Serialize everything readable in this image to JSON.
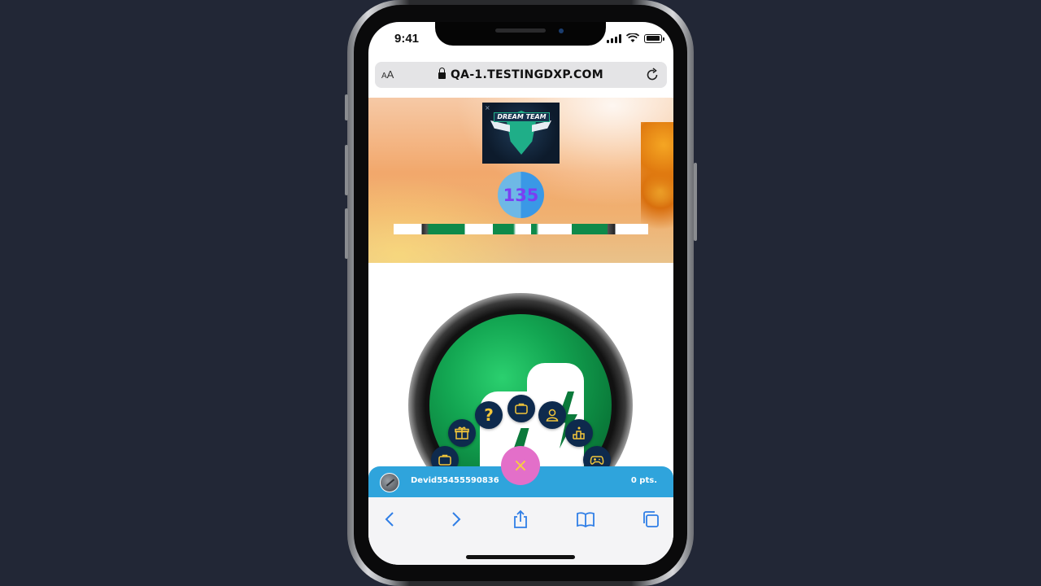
{
  "status_bar": {
    "time": "9:41"
  },
  "browser": {
    "text_size_small": "A",
    "text_size_large": "A",
    "url": "QA-1.TESTINGDXP.COM"
  },
  "banner": {
    "logo_text": "DREAM TEAM",
    "logo_close": "×",
    "score": "135"
  },
  "fab_menu": {
    "close_symbol": "×",
    "items": [
      {
        "icon": "briefcase-icon"
      },
      {
        "icon": "gift-icon"
      },
      {
        "icon": "question-icon",
        "label": "?"
      },
      {
        "icon": "briefcase-icon"
      },
      {
        "icon": "user-icon"
      },
      {
        "icon": "ranking-icon"
      },
      {
        "icon": "gamepad-icon"
      }
    ],
    "icon_color": "#f3c63a",
    "button_color": "#0e2a4d",
    "main_color": "#e36fc9"
  },
  "user_bar": {
    "username": "Devid55455590836",
    "points": "0 pts.",
    "color": "#2fa4dc"
  },
  "safari_toolbar": {
    "buttons": [
      "back-icon",
      "forward-icon",
      "share-icon",
      "bookmarks-icon",
      "tabs-icon"
    ],
    "accent": "#2f7ee6"
  }
}
